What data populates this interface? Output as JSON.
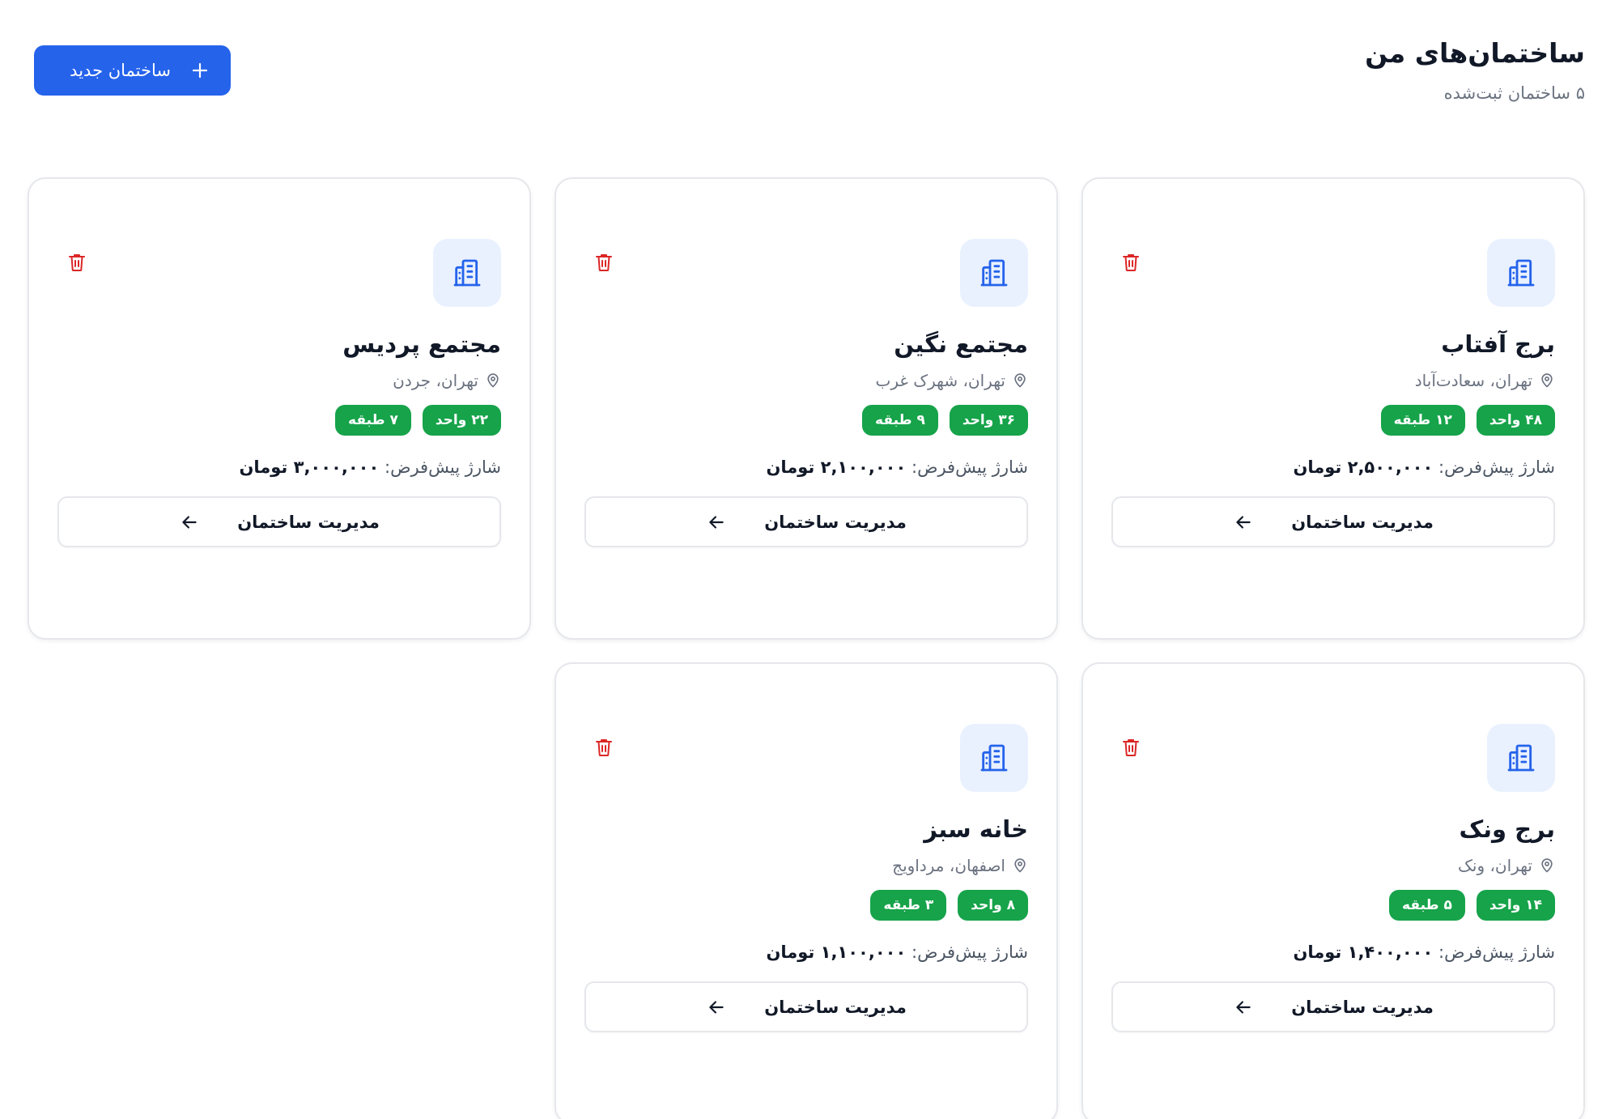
{
  "header": {
    "title": "ساختمان‌های من",
    "subtitle": "۵ ساختمان ثبت‌شده",
    "new_button_label": "ساختمان جدید"
  },
  "colors": {
    "primary": "#2563eb",
    "tag_green": "#16a34a",
    "delete_red": "#dc2626",
    "icon_bg": "#e9f1ff"
  },
  "icons": {
    "new_button": "plus-icon",
    "building": "building-icon",
    "delete": "trash-icon",
    "location": "map-pin-icon",
    "manage": "arrow-left-icon"
  },
  "buildings": [
    {
      "name": "برج آفتاب",
      "location": "تهران، سعادت‌آباد",
      "units": "۴۸ واحد",
      "floors": "۱۲ طبقه",
      "charge_label": "شارژ پیش‌فرض:",
      "charge_value": "۲,۵۰۰,۰۰۰ تومان",
      "manage_label": "مدیریت ساختمان"
    },
    {
      "name": "مجتمع نگین",
      "location": "تهران، شهرک غرب",
      "units": "۳۶ واحد",
      "floors": "۹ طبقه",
      "charge_label": "شارژ پیش‌فرض:",
      "charge_value": "۲,۱۰۰,۰۰۰ تومان",
      "manage_label": "مدیریت ساختمان"
    },
    {
      "name": "مجتمع پردیس",
      "location": "تهران، جردن",
      "units": "۲۲ واحد",
      "floors": "۷ طبقه",
      "charge_label": "شارژ پیش‌فرض:",
      "charge_value": "۳,۰۰۰,۰۰۰ تومان",
      "manage_label": "مدیریت ساختمان"
    },
    {
      "name": "برج ونک",
      "location": "تهران، ونک",
      "units": "۱۴ واحد",
      "floors": "۵ طبقه",
      "charge_label": "شارژ پیش‌فرض:",
      "charge_value": "۱,۴۰۰,۰۰۰ تومان",
      "manage_label": "مدیریت ساختمان"
    },
    {
      "name": "خانه سبز",
      "location": "اصفهان، مرداویج",
      "units": "۸ واحد",
      "floors": "۳ طبقه",
      "charge_label": "شارژ پیش‌فرض:",
      "charge_value": "۱,۱۰۰,۰۰۰ تومان",
      "manage_label": "مدیریت ساختمان"
    }
  ]
}
